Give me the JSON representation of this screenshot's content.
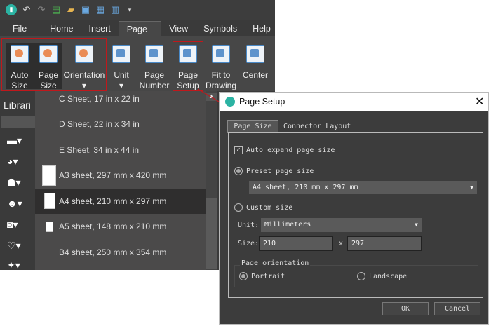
{
  "quick_access": {
    "icons": [
      "app-logo-icon",
      "undo-icon",
      "redo-icon",
      "new-icon",
      "open-icon",
      "save-icon",
      "print-icon",
      "export-icon",
      "customize-icon"
    ]
  },
  "menu_tabs": [
    "File",
    "Home",
    "Insert",
    "Page Layout",
    "View",
    "Symbols",
    "Help"
  ],
  "ribbon": [
    {
      "label1": "Auto",
      "label2": "Size"
    },
    {
      "label1": "Page",
      "label2": "Size"
    },
    {
      "label1": "Orientation",
      "label2": ""
    },
    {
      "label1": "Unit",
      "label2": ""
    },
    {
      "label1": "Page",
      "label2": "Number"
    },
    {
      "label1": "Page",
      "label2": "Setup"
    },
    {
      "label1": "Fit to",
      "label2": "Drawing"
    },
    {
      "label1": "Center",
      "label2": ""
    }
  ],
  "library": {
    "title": "Librari"
  },
  "page_size_list": [
    "C Sheet, 17 in x 22 in",
    "D Sheet, 22 in x 34 in",
    "E Sheet, 34 in x 44 in",
    "A3 sheet, 297 mm x 420 mm",
    "A4 sheet, 210 mm x 297 mm",
    "A5 sheet, 148 mm x 210 mm",
    "B4 sheet, 250 mm x 354 mm"
  ],
  "dialog": {
    "title": "Page Setup",
    "tabs": [
      "Page Size",
      "Connector Layout"
    ],
    "auto_expand": "Auto expand page size",
    "preset": "Preset page size",
    "preset_value": "A4 sheet, 210 mm x 297 mm",
    "custom": "Custom size",
    "unit_label": "Unit:",
    "unit_value": "Millimeters",
    "size_label": "Size:",
    "width": "210",
    "x": "x",
    "height": "297",
    "orientation_label": "Page orientation",
    "portrait": "Portrait",
    "landscape": "Landscape",
    "ok": "OK",
    "cancel": "Cancel"
  },
  "colors": {
    "highlight": "#c0181c"
  }
}
